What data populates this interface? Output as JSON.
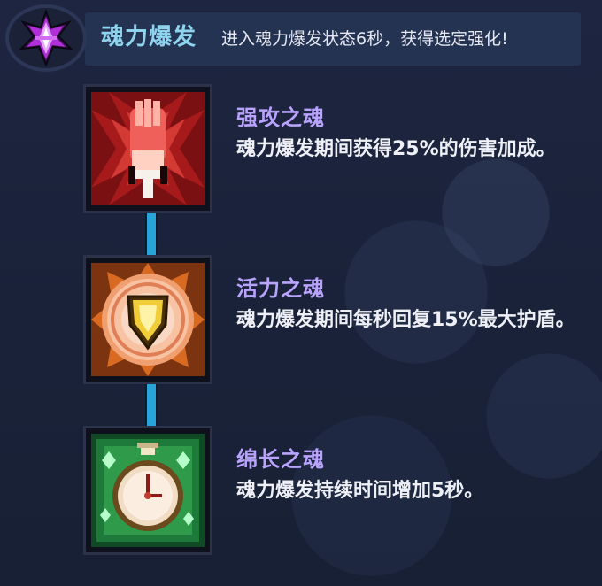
{
  "header": {
    "title": "魂力爆发",
    "description": "进入魂力爆发状态6秒，获得选定强化!",
    "icon": "purple-soul-crystal-icon"
  },
  "skills": [
    {
      "name": "强攻之魂",
      "description": "魂力爆发期间获得25%的伤害加成。",
      "icon": "red-fist-icon",
      "color": "#c0302c"
    },
    {
      "name": "活力之魂",
      "description": "魂力爆发期间每秒回复15%最大护盾。",
      "icon": "golden-shield-icon",
      "color": "#e8903a"
    },
    {
      "name": "绵长之魂",
      "description": "魂力爆发持续时间增加5秒。",
      "icon": "stopwatch-icon",
      "color": "#2e9a4a"
    }
  ],
  "colors": {
    "title": "#8fd3ee",
    "skill_name": "#b9a3ff",
    "connector": "#27a4d8",
    "background": "#1a2136"
  }
}
